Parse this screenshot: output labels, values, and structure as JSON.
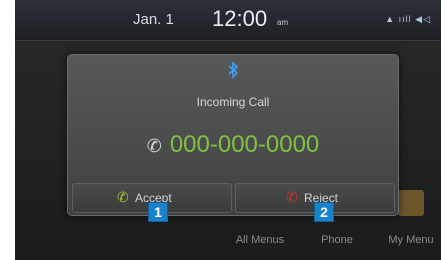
{
  "status_bar": {
    "date": "Jan. 1",
    "time": "12:00",
    "ampm": "am",
    "icons_text": "▲ ııll ◀◁"
  },
  "popup": {
    "bluetooth_icon": "bluetooth-icon",
    "title": "Incoming Call",
    "number": "000-000-0000",
    "accept_label": "Accept",
    "reject_label": "Reject"
  },
  "bottom_menu": [
    {
      "label": "All Menus",
      "icon": "all-menus-icon"
    },
    {
      "label": "Phone",
      "icon": "phone-icon"
    },
    {
      "label": "My Menu",
      "icon": "my-menu-icon"
    }
  ],
  "markers": [
    "1",
    "2"
  ],
  "colors": {
    "number": "#7fc241",
    "accept_icon": "#9ccc3a",
    "reject_icon": "#d8342c",
    "marker": "#1a82c9",
    "bluetooth": "#3aa0ff"
  }
}
